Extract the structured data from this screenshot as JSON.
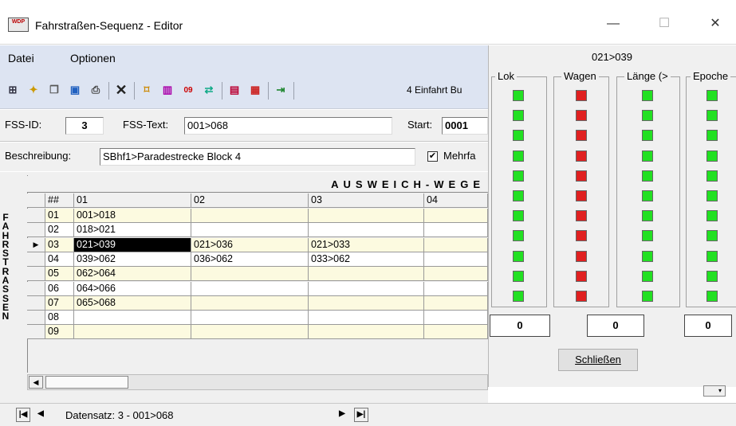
{
  "window": {
    "title": "Fahrstraßen-Sequenz - Editor",
    "icon": "app-logo-icon",
    "logo_text": "WDP"
  },
  "window_controls": {
    "minimize": "—",
    "maximize": "☐",
    "close": "✕"
  },
  "menu": {
    "datei": "Datei",
    "optionen": "Optionen"
  },
  "toolbar": {
    "info_text": "4 Einfahrt Bu"
  },
  "form": {
    "fss_id_label": "FSS-ID:",
    "fss_id_value": "3",
    "fss_text_label": "FSS-Text:",
    "fss_text_value": "001>068",
    "start_label": "Start:",
    "start_value": "0001",
    "beschreibung_label": "Beschreibung:",
    "beschreibung_value": "SBhf1>Paradestrecke Block 4",
    "mehrfach_label": "Mehrfa",
    "mehrfach_checked": "✔"
  },
  "grid": {
    "header_label": "AUSWEICH-WEGE",
    "columns": [
      "##",
      "01",
      "02",
      "03",
      "04"
    ],
    "rows": [
      [
        "01",
        "001>018",
        "",
        "",
        ""
      ],
      [
        "02",
        "018>021",
        "",
        "",
        ""
      ],
      [
        "03",
        "021>039",
        "021>036",
        "021>033",
        ""
      ],
      [
        "04",
        "039>062",
        "036>062",
        "033>062",
        ""
      ],
      [
        "05",
        "062>064",
        "",
        "",
        ""
      ],
      [
        "06",
        "064>066",
        "",
        "",
        ""
      ],
      [
        "07",
        "065>068",
        "",
        "",
        ""
      ],
      [
        "08",
        "",
        "",
        "",
        ""
      ],
      [
        "09",
        "",
        "",
        "",
        ""
      ]
    ],
    "selected_row": 2,
    "side_label": "FAHRSTRASSEN"
  },
  "statusbar": {
    "record_text": "Datensatz: 3 - 001>068"
  },
  "panel": {
    "title": "021>039",
    "groups": [
      {
        "label": "Lok",
        "lights": [
          "green",
          "green",
          "green",
          "green",
          "green",
          "green",
          "green",
          "green",
          "green",
          "green",
          "green"
        ],
        "count": "0"
      },
      {
        "label": "Wagen",
        "lights": [
          "red",
          "red",
          "red",
          "red",
          "red",
          "red",
          "red",
          "red",
          "red",
          "red",
          "red"
        ],
        "count": "0"
      },
      {
        "label": "Länge (>",
        "lights": [
          "green",
          "green",
          "green",
          "green",
          "green",
          "green",
          "green",
          "green",
          "green",
          "green",
          "green"
        ],
        "count": ""
      },
      {
        "label": "Epoche",
        "lights": [
          "green",
          "green",
          "green",
          "green",
          "green",
          "green",
          "green",
          "green",
          "green",
          "green",
          "green"
        ],
        "count": "0"
      }
    ],
    "close_label": "Schließen"
  },
  "colors": {
    "accent": "#dde4f2",
    "row_yellow": "#fcfae0",
    "light_green": "#22e022",
    "light_red": "#e02020"
  }
}
